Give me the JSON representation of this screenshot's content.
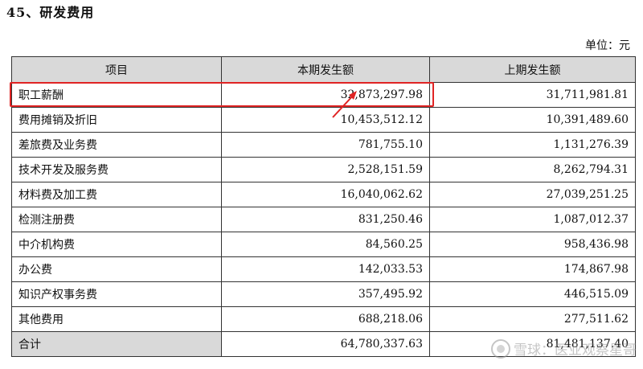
{
  "section": {
    "title": "45、研发费用"
  },
  "unit": "单位：元",
  "table": {
    "headers": [
      "项目",
      "本期发生额",
      "上期发生额"
    ],
    "rows": [
      {
        "item": "职工薪酬",
        "current": "32,873,297.98",
        "previous": "31,711,981.81"
      },
      {
        "item": "费用摊销及折旧",
        "current": "10,453,512.12",
        "previous": "10,391,489.60"
      },
      {
        "item": "差旅费及业务费",
        "current": "781,755.10",
        "previous": "1,131,276.39"
      },
      {
        "item": "技术开发及服务费",
        "current": "2,528,151.59",
        "previous": "8,262,794.31"
      },
      {
        "item": "材料费及加工费",
        "current": "16,040,062.62",
        "previous": "27,039,251.25"
      },
      {
        "item": "检测注册费",
        "current": "831,250.46",
        "previous": "1,087,012.37"
      },
      {
        "item": "中介机构费",
        "current": "84,560.25",
        "previous": "958,436.98"
      },
      {
        "item": "办公费",
        "current": "142,033.53",
        "previous": "174,867.98"
      },
      {
        "item": "知识产权事务费",
        "current": "357,495.92",
        "previous": "446,515.09"
      },
      {
        "item": "其他费用",
        "current": "688,218.06",
        "previous": "277,511.62"
      }
    ],
    "total": {
      "item": "合计",
      "current": "64,780,337.63",
      "previous": "81,481,137.40"
    }
  },
  "annotation": {
    "highlight_color": "#e02424",
    "arrow_color": "#e02424"
  },
  "watermark": {
    "text": "雪球：医业观察星哥"
  }
}
